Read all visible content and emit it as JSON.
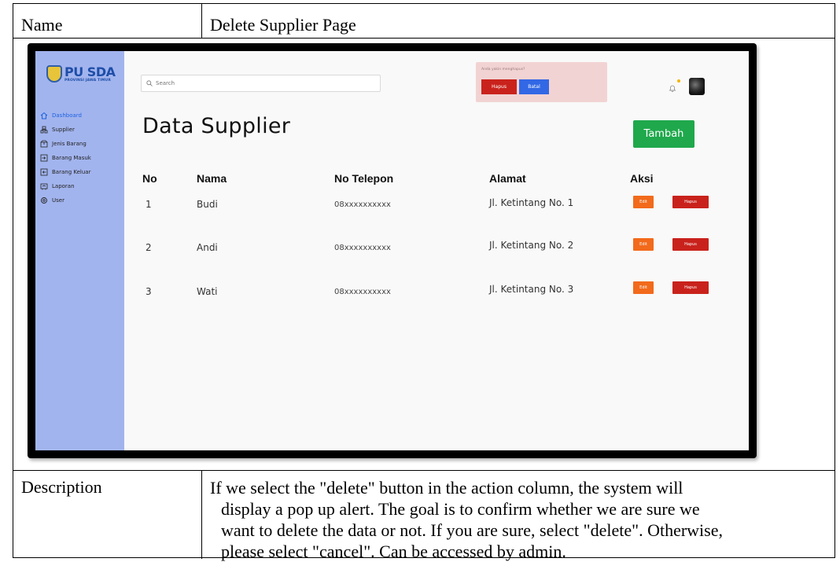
{
  "doc": {
    "name_label": "Name",
    "name_value": "Delete Supplier Page",
    "desc_label": "Description",
    "desc_lines": [
      "If we select the \"delete\" button in the action column, the system will",
      "display a pop up alert. The goal is to confirm whether we are sure we",
      "want to delete the data or not. If you are sure, select \"delete\". Otherwise,",
      "please select \"cancel\". Can be accessed by admin."
    ]
  },
  "app": {
    "logo_main": "PU SDA",
    "logo_sub": "PROVINSI JAWA TIMUR",
    "search_placeholder": "Search",
    "sidebar": [
      {
        "label": "Dashboard",
        "icon": "home-icon",
        "active": true
      },
      {
        "label": "Supplier",
        "icon": "supplier-icon",
        "active": false
      },
      {
        "label": "Jenis Barang",
        "icon": "box-icon",
        "active": false
      },
      {
        "label": "Barang Masuk",
        "icon": "inbox-icon",
        "active": false
      },
      {
        "label": "Barang Keluar",
        "icon": "outbox-icon",
        "active": false
      },
      {
        "label": "Laporan",
        "icon": "report-icon",
        "active": false
      },
      {
        "label": "User",
        "icon": "user-gear-icon",
        "active": false
      }
    ],
    "alert": {
      "message": "Anda yakin menghapus?",
      "confirm_label": "Hapus",
      "cancel_label": "Batal"
    },
    "page_title": "Data Supplier",
    "add_button": "Tambah",
    "columns": [
      "No",
      "Nama",
      "No Telepon",
      "Alamat",
      "Aksi"
    ],
    "rows": [
      {
        "no": "1",
        "nama": "Budi",
        "telepon": "08xxxxxxxxxx",
        "alamat": "Jl. Ketintang No. 1"
      },
      {
        "no": "2",
        "nama": "Andi",
        "telepon": "08xxxxxxxxxx",
        "alamat": "Jl. Ketintang No. 2"
      },
      {
        "no": "3",
        "nama": "Wati",
        "telepon": "08xxxxxxxxxx",
        "alamat": "Jl. Ketintang No. 3"
      }
    ],
    "edit_label": "Edit",
    "delete_label": "Hapus",
    "colors": {
      "sidebar": "#a2b4ee",
      "add": "#1fa84c",
      "edit": "#f26a1b",
      "delete": "#c9221c",
      "cancel": "#3268e5",
      "alert_bg": "#f2d3d3"
    }
  }
}
